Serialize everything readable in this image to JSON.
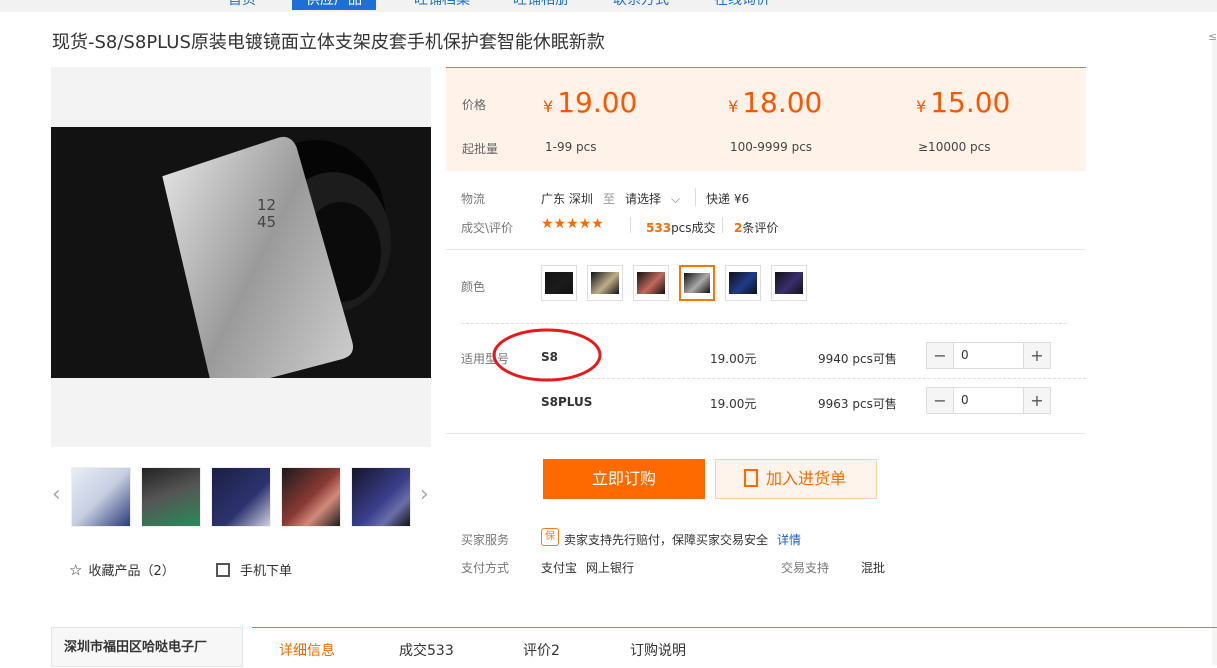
{
  "nav": {
    "items": [
      "首页",
      "供应产品",
      "旺铺档案",
      "旺铺相册",
      "联系方式",
      "在线询价"
    ]
  },
  "product": {
    "title": "现货-S8/S8PLUS原装电镀镜面立体支架皮套手机保护套智能休眠新款"
  },
  "edge_mark": "≤",
  "gallery": {
    "thumb_count": 5,
    "favorite_label": "收藏产品（2）",
    "mobile_label": "手机下单",
    "phone_clock": "12\n45"
  },
  "pricing": {
    "price_label": "价格",
    "qty_label": "起批量",
    "currency": "¥",
    "tiers": [
      {
        "price": "19.00",
        "qty": "1-99  pcs"
      },
      {
        "price": "18.00",
        "qty": "100-9999  pcs"
      },
      {
        "price": "15.00",
        "qty": "≥10000  pcs"
      }
    ]
  },
  "logistics": {
    "label": "物流",
    "origin": "广东 深圳",
    "to": "至",
    "dest": "请选择",
    "shipping": "快递 ¥6"
  },
  "deals": {
    "label": "成交\\评价",
    "stars": "★★★★★",
    "sold_count": "533",
    "sold_suffix": "pcs成交",
    "review_count": "2",
    "review_suffix": "条评价"
  },
  "color": {
    "label": "颜色",
    "swatches": [
      "#1b1b1b",
      "#bfae8a",
      "#c06a5a",
      "#a9a9a9",
      "#1e3b8a",
      "#3b2e6e"
    ],
    "selected": 3
  },
  "models": {
    "label": "适用型号",
    "rows": [
      {
        "name": "S8",
        "price": "19.00元",
        "stock": "9940 pcs可售",
        "qty": "0"
      },
      {
        "name": "S8PLUS",
        "price": "19.00元",
        "stock": "9963 pcs可售",
        "qty": "0"
      }
    ]
  },
  "actions": {
    "buy": "立即订购",
    "cart": "加入进货单"
  },
  "service": {
    "seller_label": "买家服务",
    "badge": "保",
    "seller_text": "卖家支持先行赔付，保障买家交易安全",
    "detail_link": "详情",
    "pay_label": "支付方式",
    "pay_methods": [
      "支付宝",
      "网上银行"
    ],
    "trade_label": "交易支持",
    "trade_value": "混批"
  },
  "shop": {
    "name": "深圳市福田区哈哒电子厂"
  },
  "tabs": [
    "详细信息",
    "成交533",
    "评价2",
    "订购说明"
  ],
  "colors": {
    "accent": "#ff6a00",
    "nav_active": "#1d6fd6",
    "circle": "#e8191b"
  }
}
